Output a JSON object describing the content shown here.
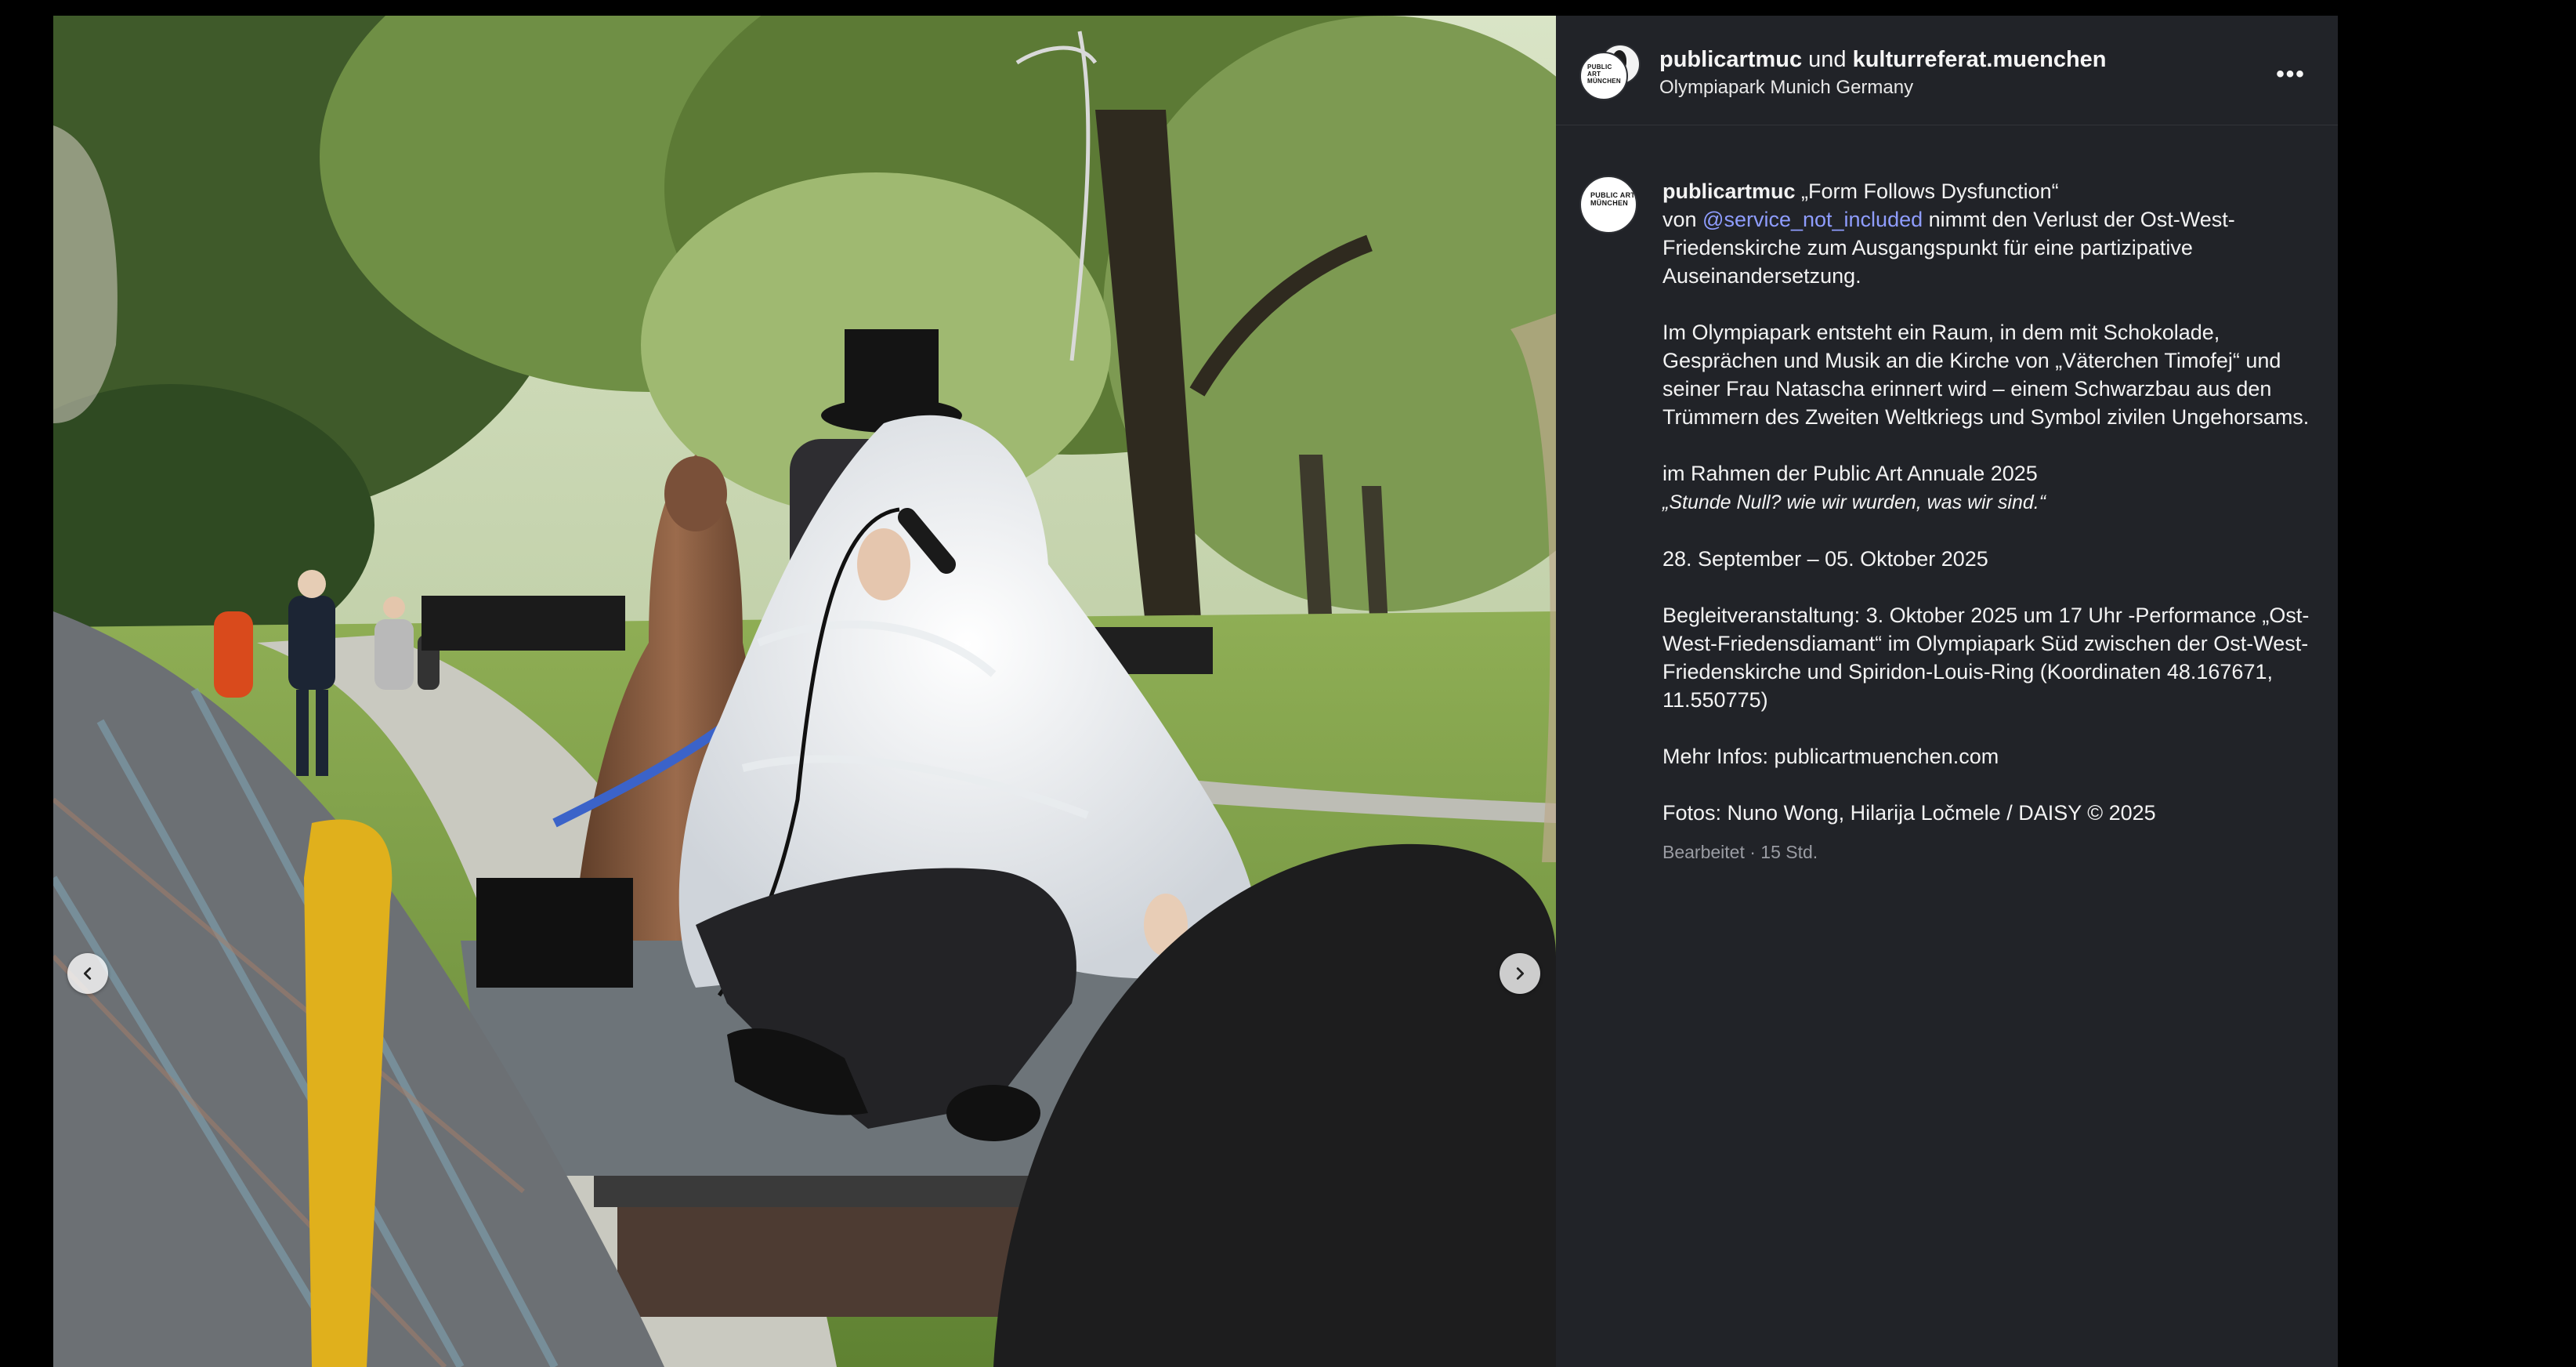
{
  "post": {
    "author": "publicartmuc",
    "connector": " und ",
    "collaborator": "kulturreferat.muenchen",
    "location": "Olympiapark Munich Germany",
    "avatar_label": "PUBLIC ART MÜNCHEN"
  },
  "caption": {
    "username": "publicartmuc",
    "title_line": " „Form Follows Dysfunction“",
    "von": "von ",
    "mention": "@service_not_included",
    "para1_rest": " nimmt den Verlust der Ost-West-Friedenskirche zum Ausgangspunkt für eine partizipative Auseinandersetzung.",
    "para2": "Im Olympiapark entsteht ein Raum, in dem mit Schokolade, Gesprächen und Musik an die Kirche von „Väterchen Timofej“ und seiner Frau Natascha erinnert wird – einem Schwarzbau aus den Trümmern des Zweiten Weltkriegs und Symbol zivilen Ungehorsams.",
    "para3_line1": "im Rahmen der Public Art Annuale 2025",
    "para3_line2": "„Stunde Null? wie wir wurden, was wir sind.“",
    "para4": "28. September – 05. Oktober 2025",
    "para5": "Begleitveranstaltung: 3. Oktober 2025 um 17 Uhr -Performance „Ost-West-Friedensdiamant“ im Olympiapark Süd zwischen der Ost-West-Friedenskirche und Spiridon-Louis-Ring (Koordinaten 48.167671, 11.550775)",
    "para6": "Mehr Infos: publicartmuenchen.com",
    "para7": "Fotos: Nuno Wong, Hilarija Ločmele / DAISY © 2025",
    "meta": "Bearbeitet · 15 Std."
  },
  "icons": {
    "prev": "chevron-left-icon",
    "next": "chevron-right-icon",
    "more": "more-horizontal-icon"
  },
  "colors": {
    "panel_bg": "#212328",
    "mention": "#8f9dff",
    "meta": "#9a9ca3"
  }
}
